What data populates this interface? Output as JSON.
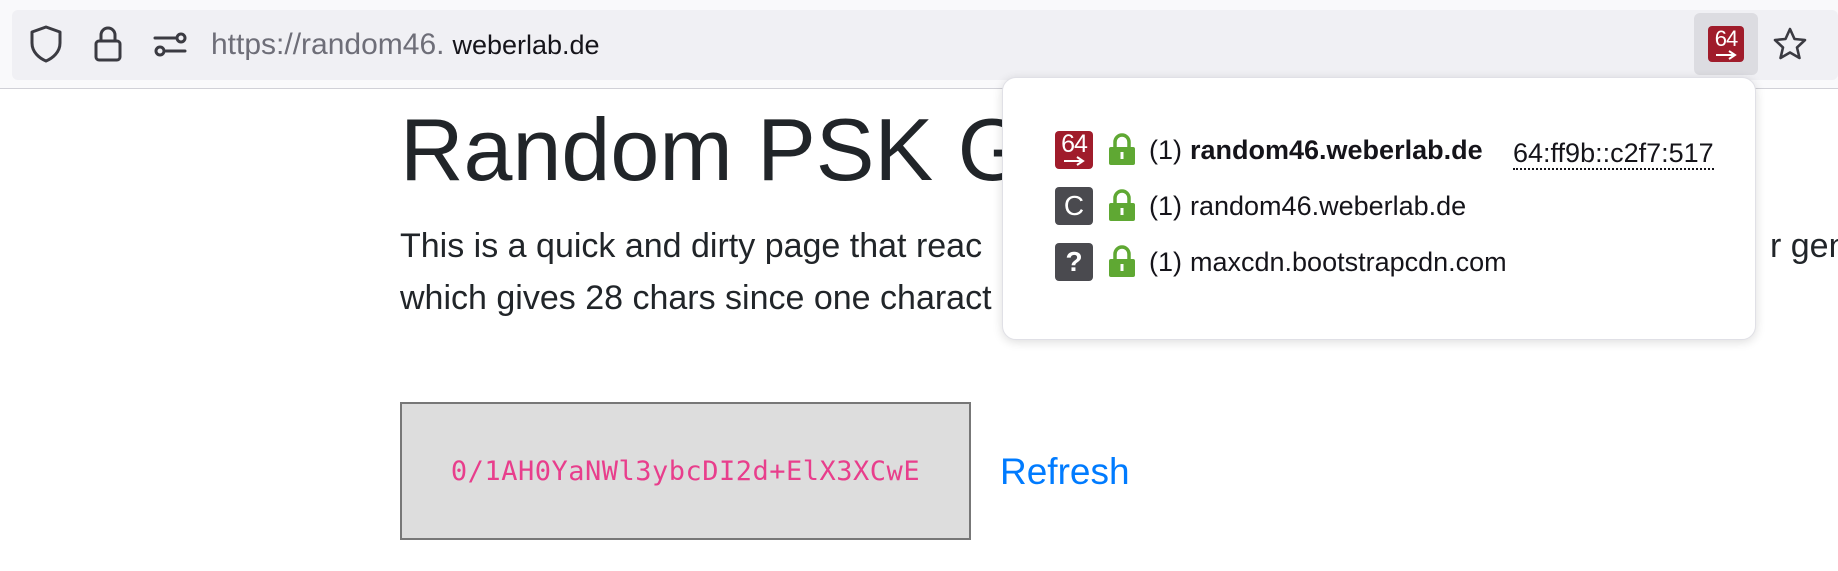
{
  "browser": {
    "url_prefix": "https://random46.",
    "url_host": "weberlab.de",
    "extension_badge": "64",
    "icons": [
      "shield-icon",
      "lock-icon",
      "permissions-icon",
      "bookmark-star-icon"
    ]
  },
  "page": {
    "title": "Random PSK Ge",
    "lead_line_1": "This is a quick and dirty page that reac",
    "lead_line_1_right": "r gen",
    "lead_line_2": "which gives 28 chars since one charact",
    "psk_value": "0/1AH0YaNWl3ybcDI2d+ElX3XCwE",
    "refresh_label": "Refresh"
  },
  "popup": {
    "rows": [
      {
        "type": "64",
        "count": "(1)",
        "host": "random46.weberlab.de",
        "address": "64:ff9b::c2f7:517"
      },
      {
        "type": "C",
        "count": "(1)",
        "host": "random46.weberlab.de"
      },
      {
        "type": "?",
        "count": "(1)",
        "host": "maxcdn.bootstrapcdn.com"
      }
    ]
  },
  "colors": {
    "badge_red": "#a01c2b",
    "lock_green": "#5fa833",
    "link_blue": "#007bff",
    "code_pink": "#e83e8c"
  }
}
